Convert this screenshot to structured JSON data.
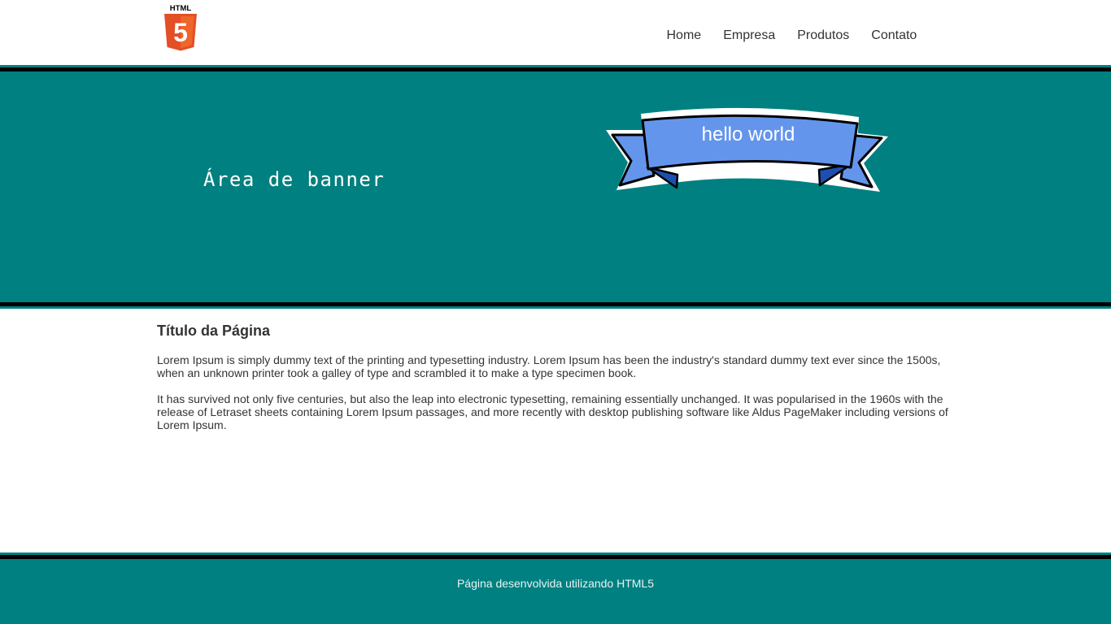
{
  "header": {
    "logo": {
      "icon": "html5-logo-icon",
      "label": "HTML",
      "digit": "5",
      "colors": {
        "shield": "#e34f26",
        "shield_light": "#ef652a",
        "text": "#000000"
      }
    },
    "nav": [
      {
        "label": "Home"
      },
      {
        "label": "Empresa"
      },
      {
        "label": "Produtos"
      },
      {
        "label": "Contato"
      }
    ]
  },
  "banner": {
    "text": "Área de banner",
    "ribbon_text": "hello world",
    "colors": {
      "background": "#008080",
      "ribbon_fill": "#6495ed",
      "ribbon_fold": "#1e4fb0",
      "stripe": "#000000"
    }
  },
  "main": {
    "title": "Título da Página",
    "paragraphs": [
      "Lorem Ipsum is simply dummy text of the printing and typesetting industry. Lorem Ipsum has been the industry's standard dummy text ever since the 1500s, when an unknown printer took a galley of type and scrambled it to make a type specimen book.",
      "It has survived not only five centuries, but also the leap into electronic typesetting, remaining essentially unchanged. It was popularised in the 1960s with the release of Letraset sheets containing Lorem Ipsum passages, and more recently with desktop publishing software like Aldus PageMaker including versions of Lorem Ipsum."
    ]
  },
  "footer": {
    "text": "Página desenvolvida utilizando HTML5"
  }
}
